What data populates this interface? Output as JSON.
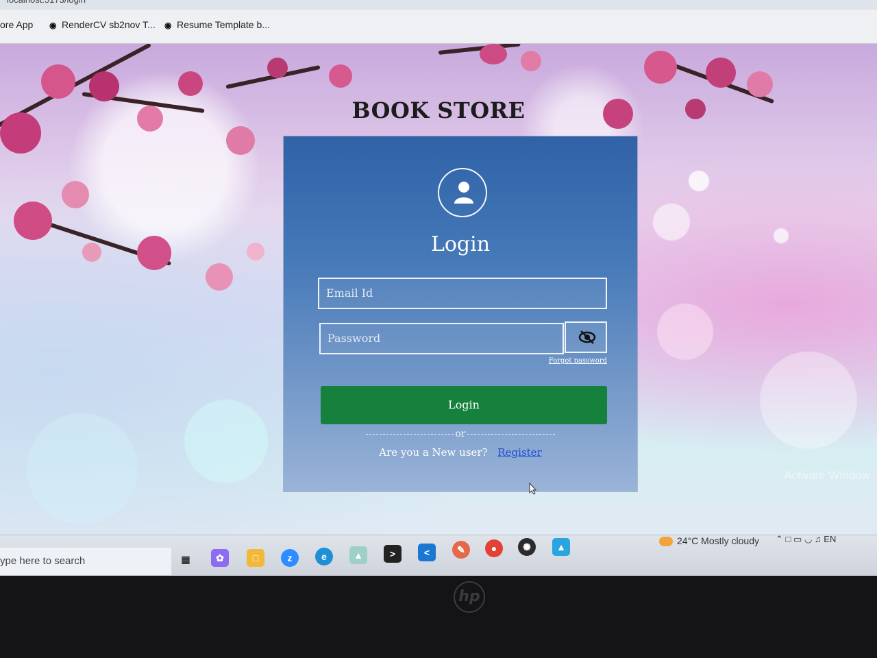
{
  "browser": {
    "bookmarks": [
      {
        "label": "ore App",
        "icon": "app-icon"
      },
      {
        "label": "RenderCV sb2nov T...",
        "icon": "github-icon"
      },
      {
        "label": "Resume Template b...",
        "icon": "github-icon"
      }
    ]
  },
  "page": {
    "title": "BOOK STORE",
    "login_heading": "Login",
    "email_placeholder": "Email Id",
    "password_placeholder": "Password",
    "forgot_password": "Forgot password",
    "login_button": "Login",
    "or_text": "or",
    "new_user_text": "Are you a New user?",
    "register_link": "Register",
    "brand_color": "#16803d",
    "card_color": "#3a6db0"
  },
  "watermark": "Activate Window",
  "taskbar": {
    "search_placeholder": "ype here to search",
    "weather": "24°C  Mostly cloudy",
    "language": "EN"
  }
}
